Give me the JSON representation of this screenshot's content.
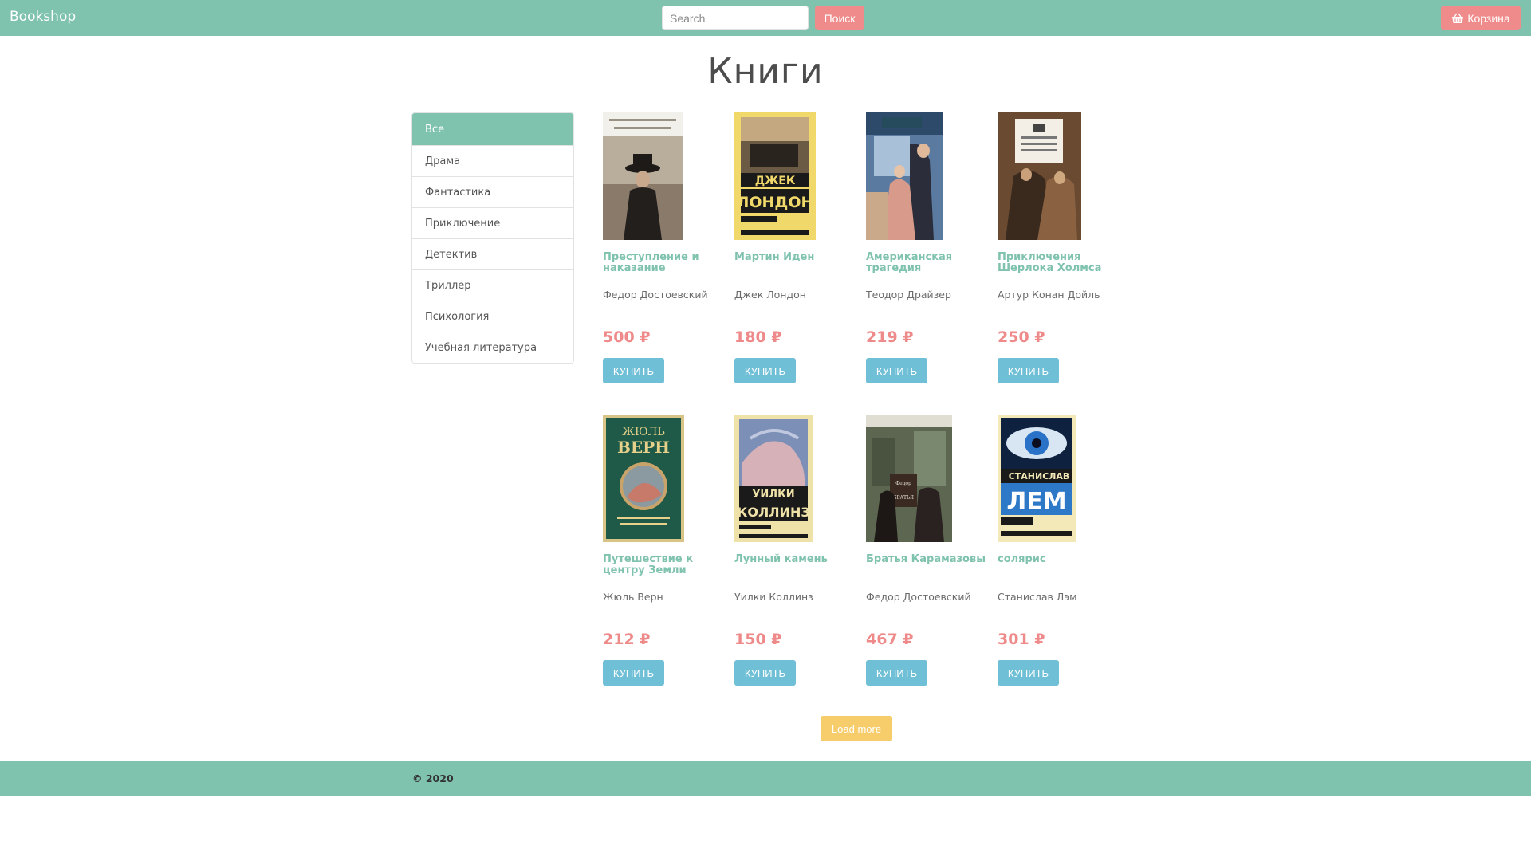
{
  "navbar": {
    "brand": "Bookshop",
    "search_placeholder": "Search",
    "search_button": "Поиск",
    "cart_label": "Корзина",
    "cart_icon": "basket-icon"
  },
  "page_title": "Книги",
  "sidebar": {
    "items": [
      {
        "label": "Все",
        "active": true
      },
      {
        "label": "Драма",
        "active": false
      },
      {
        "label": "Фантастика",
        "active": false
      },
      {
        "label": "Приключение",
        "active": false
      },
      {
        "label": "Детектив",
        "active": false
      },
      {
        "label": "Триллер",
        "active": false
      },
      {
        "label": "Психология",
        "active": false
      },
      {
        "label": "Учебная литература",
        "active": false
      }
    ]
  },
  "books": [
    {
      "title": "Преступление и наказание",
      "author": "Федор Достоевский",
      "price": "500 ₽",
      "buy": "КУПИТЬ"
    },
    {
      "title": "Мартин Иден",
      "author": "Джек Лондон",
      "price": "180 ₽",
      "buy": "КУПИТЬ"
    },
    {
      "title": "Американская трагедия",
      "author": "Теодор Драйзер",
      "price": "219 ₽",
      "buy": "КУПИТЬ"
    },
    {
      "title": "Приключения Шерлока Холмса",
      "author": "Артур Конан Дойль",
      "price": "250 ₽",
      "buy": "КУПИТЬ"
    },
    {
      "title": "Путешествие к центру Земли",
      "author": "Жюль Верн",
      "price": "212 ₽",
      "buy": "КУПИТЬ"
    },
    {
      "title": "Лунный камень",
      "author": "Уилки Коллинз",
      "price": "150 ₽",
      "buy": "КУПИТЬ"
    },
    {
      "title": "Братья Карамазовы",
      "author": "Федор Достоевский",
      "price": "467 ₽",
      "buy": "КУПИТЬ"
    },
    {
      "title": "солярис",
      "author": "Станислав Лэм",
      "price": "301 ₽",
      "buy": "КУПИТЬ"
    }
  ],
  "load_more": "Load more",
  "footer": {
    "copyright": "© 2020"
  },
  "colors": {
    "accent": "#7fc2ae",
    "price": "#ef8a8a",
    "buy_button": "#6fbfd6",
    "search_button": "#f08b8b",
    "load_more": "#f7cd6b"
  }
}
